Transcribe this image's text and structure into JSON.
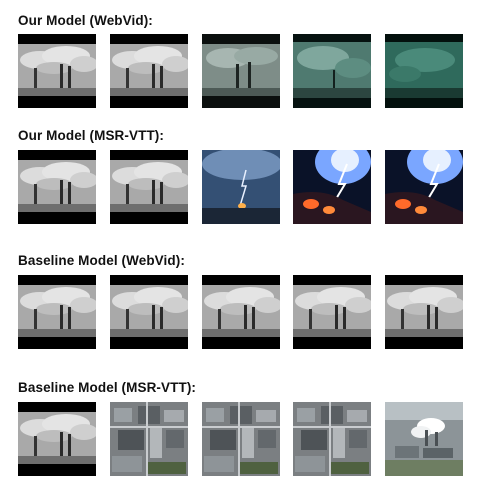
{
  "rows": [
    {
      "label": "Our Model (WebVid):",
      "frames": [
        "smoke-stacks",
        "smoke-stacks",
        "smoke-stacks-teal",
        "smoke-teal",
        "smoke-teal-dark"
      ]
    },
    {
      "label": "Our Model (MSR-VTT):",
      "frames": [
        "smoke-stacks",
        "smoke-stacks",
        "lightning-blue",
        "lightning-fire",
        "lightning-fire"
      ]
    },
    {
      "label": "Baseline Model (WebVid):",
      "frames": [
        "smoke-stacks",
        "smoke-stacks",
        "smoke-stacks",
        "smoke-stacks",
        "smoke-stacks"
      ]
    },
    {
      "label": "Baseline Model (MSR-VTT):",
      "frames": [
        "smoke-stacks",
        "aerial-city",
        "aerial-city",
        "aerial-city",
        "aerial-industrial"
      ]
    }
  ]
}
